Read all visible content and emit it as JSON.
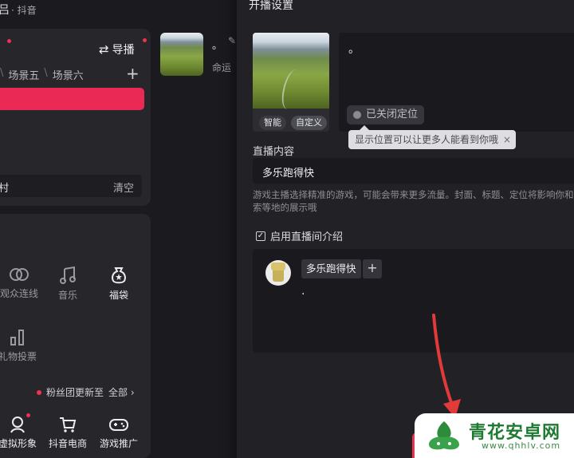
{
  "topbar": {
    "logo_glyph": "吕",
    "app_name": "· 抖音"
  },
  "left_panel": {
    "guide_label": "导播",
    "scenes": [
      "场景五",
      "场景六"
    ],
    "add_label": "+",
    "clear_row": {
      "left_text": "村",
      "clear_label": "清空"
    },
    "tools": [
      {
        "label": "观众连线",
        "icon": "audience-link-icon"
      },
      {
        "label": "音乐",
        "icon": "music-icon"
      },
      {
        "label": "福袋",
        "icon": "lucky-bag-icon"
      },
      {
        "label": "礼物投票",
        "icon": "gift-vote-icon"
      },
      {
        "label": "虚拟形象",
        "icon": "avatar-icon"
      },
      {
        "label": "抖音电商",
        "icon": "cart-icon"
      },
      {
        "label": "游戏推广",
        "icon": "gamepad-icon"
      }
    ],
    "fans_update": "粉丝团更新至",
    "fans_all": "全部 ›"
  },
  "stream_item": {
    "title": "。",
    "subtitle": "命运"
  },
  "modal": {
    "title": "开播设置",
    "cover_buttons": {
      "smart": "智能",
      "custom": "自定义"
    },
    "title_text": "。",
    "location_button": "已关闭定位",
    "location_tooltip": "显示位置可以让更多人能看到你哦",
    "tooltip_close": "×",
    "content_label": "直播内容",
    "game_value": "多乐跑得快",
    "note": "游戏主播选择精准的游戏，可能会带来更多流量。封面、标题、定位将影响你和搜索等地的展示哦",
    "intro_checkbox": "启用直播间介绍",
    "intro_tag": "多乐跑得快",
    "intro_add": "+",
    "intro_text": "."
  },
  "watermark": {
    "name": "青花安卓网",
    "url": "www.qhhlv.com"
  },
  "colors": {
    "accent": "#ea2a55",
    "background": "#1b1b1f",
    "modal": "#222226",
    "watermark_green": "#1f7a31"
  }
}
